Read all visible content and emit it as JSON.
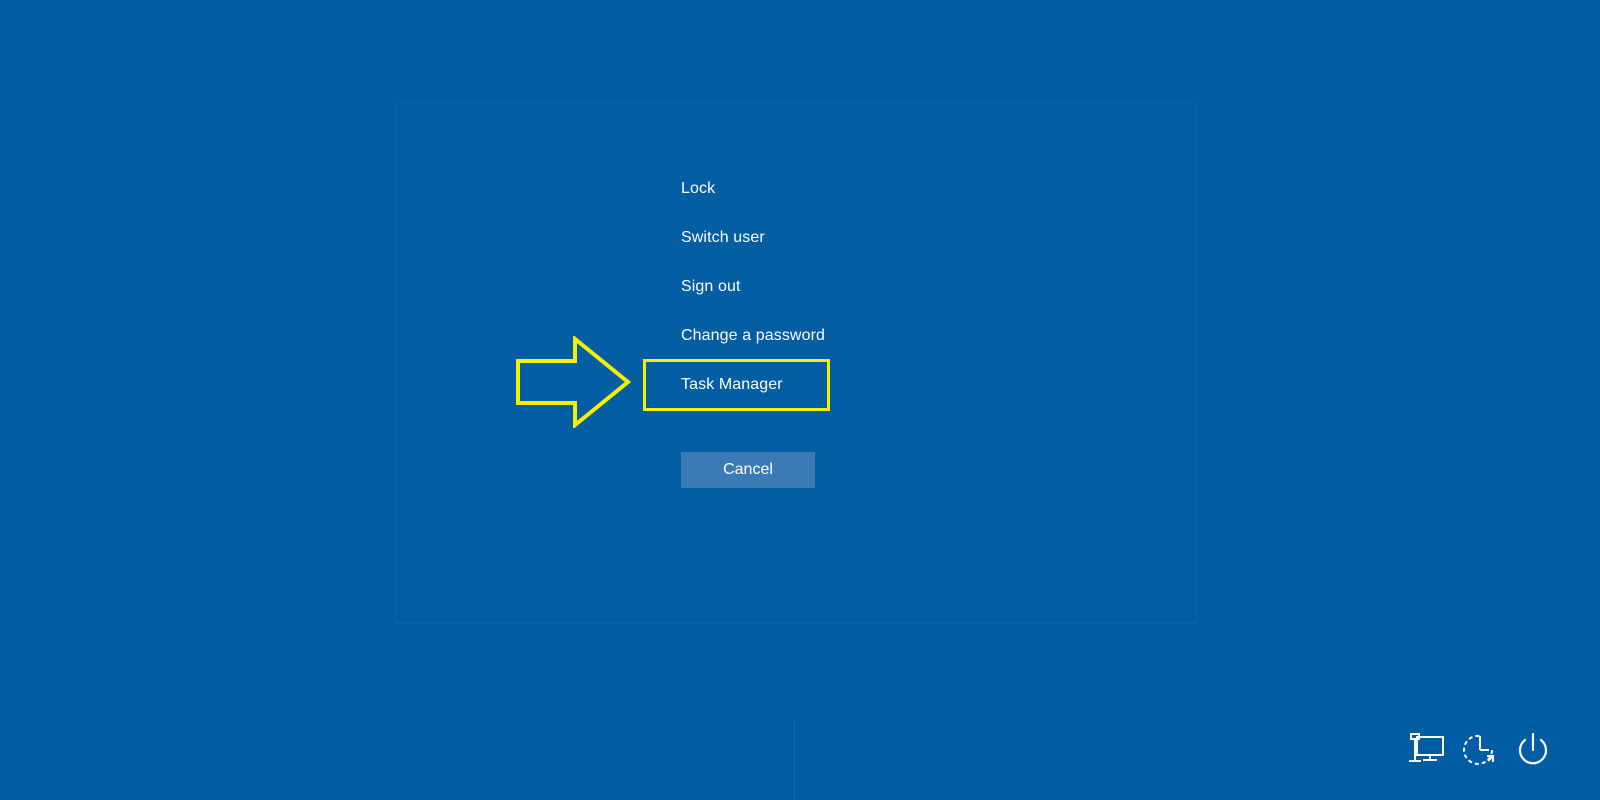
{
  "menu": {
    "items": [
      {
        "label": "Lock"
      },
      {
        "label": "Switch user"
      },
      {
        "label": "Sign out"
      },
      {
        "label": "Change a password"
      },
      {
        "label": "Task Manager"
      }
    ]
  },
  "cancel": {
    "label": "Cancel"
  },
  "annotation": {
    "highlight_color": "#f5f000",
    "highlighted_item": "Task Manager"
  },
  "tray": {
    "icons": [
      "network-icon",
      "ease-of-access-icon",
      "power-icon"
    ]
  },
  "colors": {
    "background": "#005ca3",
    "button": "#3a7bb5",
    "text": "#ffffff"
  }
}
